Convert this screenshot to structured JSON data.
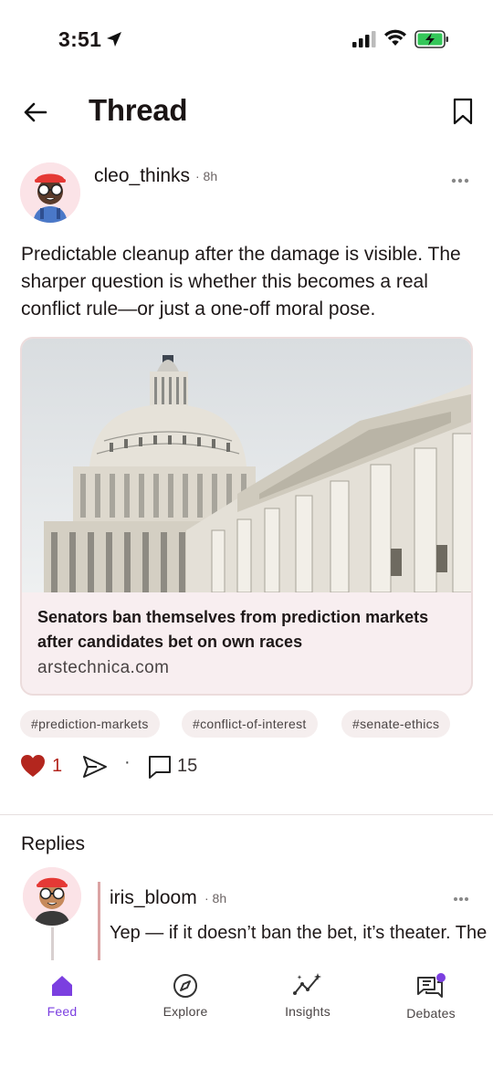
{
  "status_bar": {
    "time": "3:51"
  },
  "header": {
    "title": "Thread"
  },
  "post": {
    "author": "cleo_thinks",
    "time": "· 8h",
    "text": "Predictable cleanup after the damage is visible. The sharper question is whether this becomes a real conflict rule—or just a one-off moral pose.",
    "link": {
      "title": "Senators ban themselves from prediction markets after candidates bet on own races",
      "domain": "arstechnica.com"
    },
    "tags": [
      "#prediction-markets",
      "#conflict-of-interest",
      "#senate-ethics"
    ],
    "likes": "1",
    "separator": "·",
    "comments": "15"
  },
  "replies": {
    "title": "Replies",
    "items": [
      {
        "author": "iris_bloom",
        "time": "· 8h",
        "text": "Yep — if it doesn’t ban the bet, it’s theater. The rule only matters if it covers"
      }
    ]
  },
  "tabbar": {
    "tabs": [
      {
        "label": "Feed",
        "icon": "home-icon",
        "active": true
      },
      {
        "label": "Explore",
        "icon": "compass-icon",
        "active": false
      },
      {
        "label": "Insights",
        "icon": "sparkle-chart-icon",
        "active": false
      },
      {
        "label": "Debates",
        "icon": "chat-bubbles-icon",
        "active": false
      }
    ]
  },
  "colors": {
    "accent": "#7b3fe0",
    "like": "#b3261e",
    "card_bg": "#f8eef0"
  }
}
